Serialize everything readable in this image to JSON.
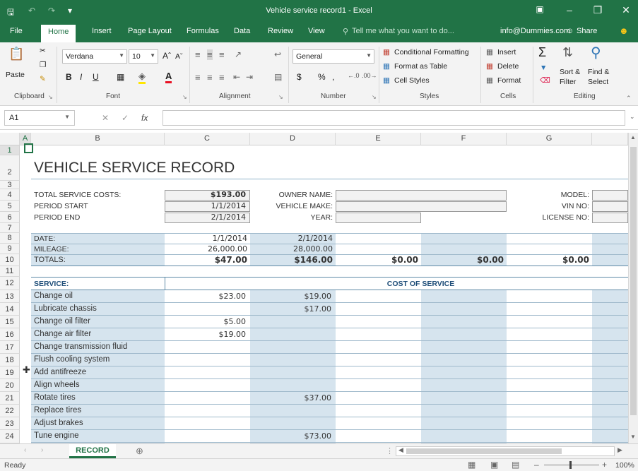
{
  "window": {
    "title": "Vehicle service record1 - Excel"
  },
  "tabs": [
    "File",
    "Home",
    "Insert",
    "Page Layout",
    "Formulas",
    "Data",
    "Review",
    "View"
  ],
  "tell_me": "Tell me what you want to do...",
  "account": "info@Dummies.com",
  "share": "Share",
  "clipboard": {
    "paste": "Paste",
    "label": "Clipboard"
  },
  "font": {
    "name": "Verdana",
    "size": "10",
    "bold": "B",
    "italic": "I",
    "underline": "U",
    "label": "Font"
  },
  "alignment": {
    "label": "Alignment"
  },
  "number": {
    "format": "General",
    "currency": "$",
    "percent": "%",
    "comma": ",",
    "label": "Number"
  },
  "styles": {
    "conditional": "Conditional Formatting",
    "format_table": "Format as Table",
    "cell_styles": "Cell Styles",
    "label": "Styles"
  },
  "cells": {
    "insert": "Insert",
    "delete": "Delete",
    "format": "Format",
    "label": "Cells"
  },
  "editing": {
    "sort": "Sort &",
    "filter": "Filter",
    "find": "Find &",
    "select": "Select",
    "label": "Editing"
  },
  "formula_bar": {
    "name_box": "A1",
    "fx": "fx",
    "value": ""
  },
  "columns": [
    "A",
    "B",
    "C",
    "D",
    "E",
    "F",
    "G"
  ],
  "rows": [
    "1",
    "2",
    "3",
    "4",
    "5",
    "6",
    "7",
    "8",
    "9",
    "10",
    "11",
    "12",
    "13",
    "14",
    "15",
    "16",
    "17",
    "18",
    "19",
    "20",
    "21",
    "22",
    "23",
    "24"
  ],
  "sheet": {
    "title": "VEHICLE SERVICE RECORD",
    "total_costs_label": "TOTAL SERVICE COSTS:",
    "total_costs": "$193.00",
    "period_start_label": "PERIOD START",
    "period_start": "1/1/2014",
    "period_end_label": "PERIOD END",
    "period_end": "2/1/2014",
    "owner_label": "OWNER NAME:",
    "make_label": "VEHICLE MAKE:",
    "year_label": "YEAR:",
    "model_label": "MODEL:",
    "vin_label": "VIN NO:",
    "license_label": "LICENSE NO:",
    "date_label": "DATE:",
    "mileage_label": "MILEAGE:",
    "totals_label": "TOTALS:",
    "dates": [
      "1/1/2014",
      "2/1/2014"
    ],
    "mileages": [
      "26,000.00",
      "28,000.00"
    ],
    "totals": [
      "$47.00",
      "$146.00",
      "$0.00",
      "$0.00",
      "$0.00"
    ],
    "service_label": "SERVICE:",
    "cost_label": "COST OF SERVICE",
    "services": [
      {
        "name": "Change oil",
        "c": "$23.00",
        "d": "$19.00"
      },
      {
        "name": "Lubricate chassis",
        "c": "",
        "d": "$17.00"
      },
      {
        "name": "Change oil filter",
        "c": "$5.00",
        "d": ""
      },
      {
        "name": "Change air filter",
        "c": "$19.00",
        "d": ""
      },
      {
        "name": "Change transmission fluid",
        "c": "",
        "d": ""
      },
      {
        "name": "Flush cooling system",
        "c": "",
        "d": ""
      },
      {
        "name": "Add antifreeze",
        "c": "",
        "d": ""
      },
      {
        "name": "Align wheels",
        "c": "",
        "d": ""
      },
      {
        "name": "Rotate tires",
        "c": "",
        "d": "$37.00"
      },
      {
        "name": "Replace tires",
        "c": "",
        "d": ""
      },
      {
        "name": "Adjust brakes",
        "c": "",
        "d": ""
      },
      {
        "name": "Tune engine",
        "c": "",
        "d": "$73.00"
      }
    ]
  },
  "sheet_tab": "RECORD",
  "status": {
    "ready": "Ready",
    "zoom": "100%"
  },
  "colors": {
    "excel_green": "#217346",
    "band": "#d6e4ee"
  }
}
